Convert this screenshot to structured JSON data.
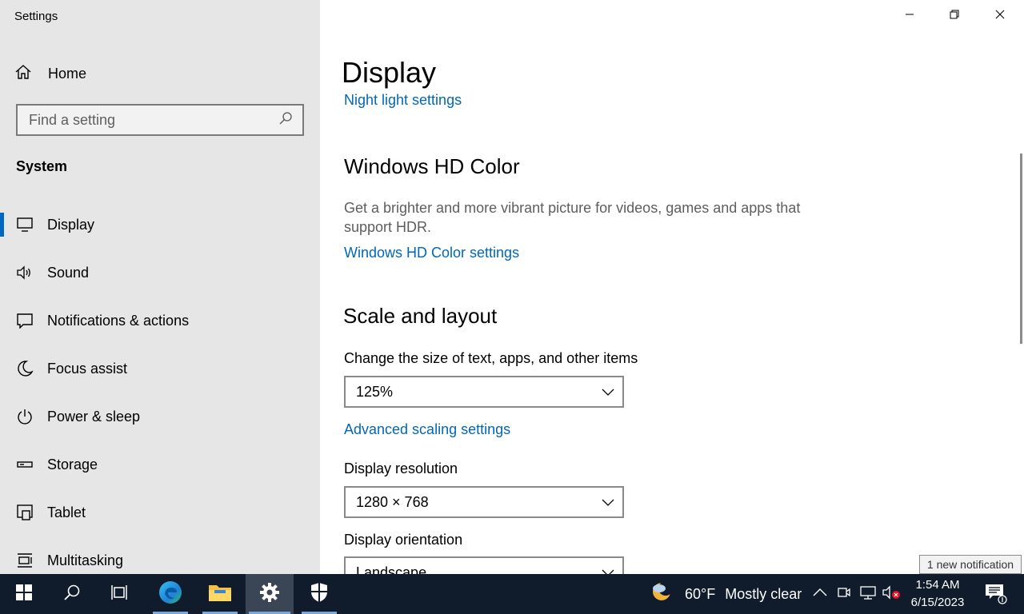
{
  "window": {
    "title": "Settings",
    "minimize_icon": "minimize-icon",
    "maximize_icon": "restore-icon",
    "close_icon": "close-icon"
  },
  "sidebar": {
    "home_label": "Home",
    "search_placeholder": "Find a setting",
    "section_title": "System",
    "items": [
      {
        "label": "Display",
        "icon": "monitor-icon",
        "selected": true
      },
      {
        "label": "Sound",
        "icon": "speaker-icon"
      },
      {
        "label": "Notifications & actions",
        "icon": "notification-icon"
      },
      {
        "label": "Focus assist",
        "icon": "moon-icon"
      },
      {
        "label": "Power & sleep",
        "icon": "power-icon"
      },
      {
        "label": "Storage",
        "icon": "storage-icon"
      },
      {
        "label": "Tablet",
        "icon": "tablet-icon"
      },
      {
        "label": "Multitasking",
        "icon": "multitasking-icon"
      }
    ]
  },
  "main": {
    "page_title": "Display",
    "night_light_link": "Night light settings",
    "hd_color": {
      "heading": "Windows HD Color",
      "description": "Get a brighter and more vibrant picture for videos, games and apps that support HDR.",
      "link": "Windows HD Color settings"
    },
    "scale_layout": {
      "heading": "Scale and layout",
      "scale_label": "Change the size of text, apps, and other items",
      "scale_value": "125%",
      "advanced_link": "Advanced scaling settings",
      "resolution_label": "Display resolution",
      "resolution_value": "1280 × 768",
      "orientation_label": "Display orientation",
      "orientation_value": "Landscape"
    }
  },
  "taskbar": {
    "weather": {
      "temp": "60°F",
      "condition": "Mostly clear"
    },
    "clock": {
      "time": "1:54 AM",
      "date": "6/15/2023"
    },
    "notification_tooltip": "1 new notification"
  },
  "colors": {
    "accent": "#0067b8",
    "sidebar_bg": "#e6e6e6",
    "taskbar_bg": "#101c2c"
  }
}
